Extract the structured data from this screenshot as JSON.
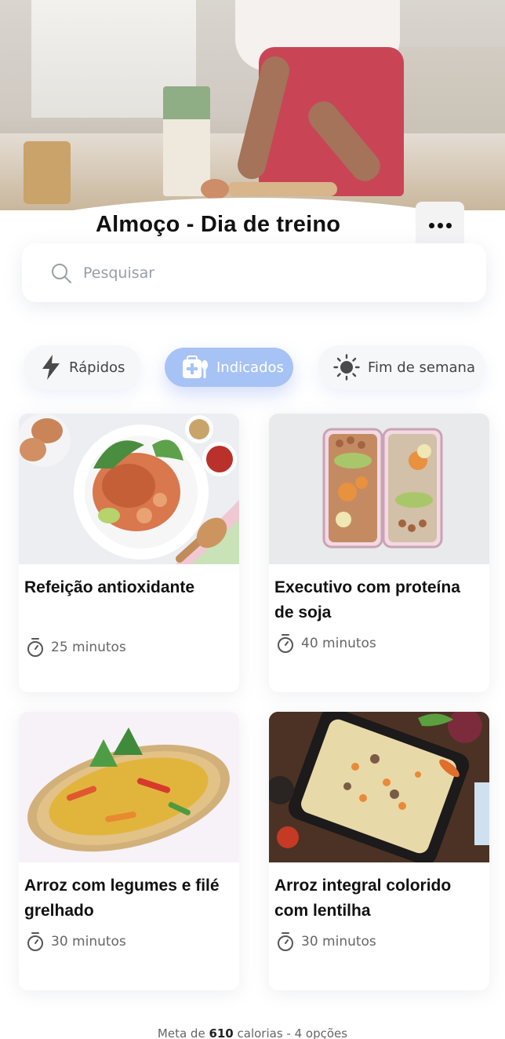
{
  "header": {
    "title": "Almoço - Dia de treino"
  },
  "search": {
    "placeholder": "Pesquisar"
  },
  "filters": [
    {
      "label": "Rápidos",
      "icon": "bolt-icon",
      "active": false
    },
    {
      "label": "Indicados",
      "icon": "first-aid-kit-icon",
      "active": true
    },
    {
      "label": "Fim de semana",
      "icon": "sun-icon",
      "active": false
    }
  ],
  "recipes": [
    {
      "name": "Refeição antioxidante",
      "time": "25 minutos"
    },
    {
      "name": "Executivo com proteína de soja",
      "time": "40 minutos"
    },
    {
      "name": "Arroz com legumes e filé grelhado",
      "time": "30 minutos"
    },
    {
      "name": "Arroz integral colorido com lentilha",
      "time": "30 minutos"
    }
  ],
  "footer": {
    "prefix": "Meta de ",
    "calories": "610",
    "suffix": " calorias - 4 opções"
  },
  "colors": {
    "accent": "#a7c3f5",
    "chip_bg": "#f6f7f8",
    "apron": "#c94556"
  }
}
